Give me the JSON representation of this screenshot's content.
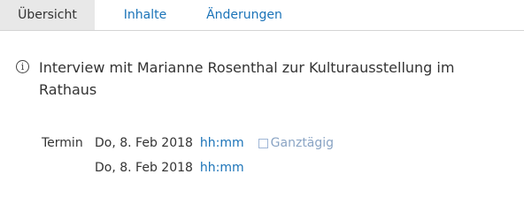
{
  "tabs": [
    {
      "label": "Übersicht",
      "active": true
    },
    {
      "label": "Inhalte",
      "active": false
    },
    {
      "label": "Änderungen",
      "active": false
    }
  ],
  "info_icon": "info-icon",
  "title": "Interview mit Marianne Rosenthal zur Kulturausstellung im Rathaus",
  "termin": {
    "label": "Termin",
    "start": {
      "date": "Do, 8. Feb 2018",
      "time": "hh:mm",
      "allday_label": "Ganztägig",
      "allday_checked": false
    },
    "end": {
      "date": "Do, 8. Feb 2018",
      "time": "hh:mm"
    }
  },
  "colors": {
    "link": "#1a73b8",
    "active_tab_bg": "#e8e8e8",
    "checkbox_label": "#8aa4c4"
  }
}
